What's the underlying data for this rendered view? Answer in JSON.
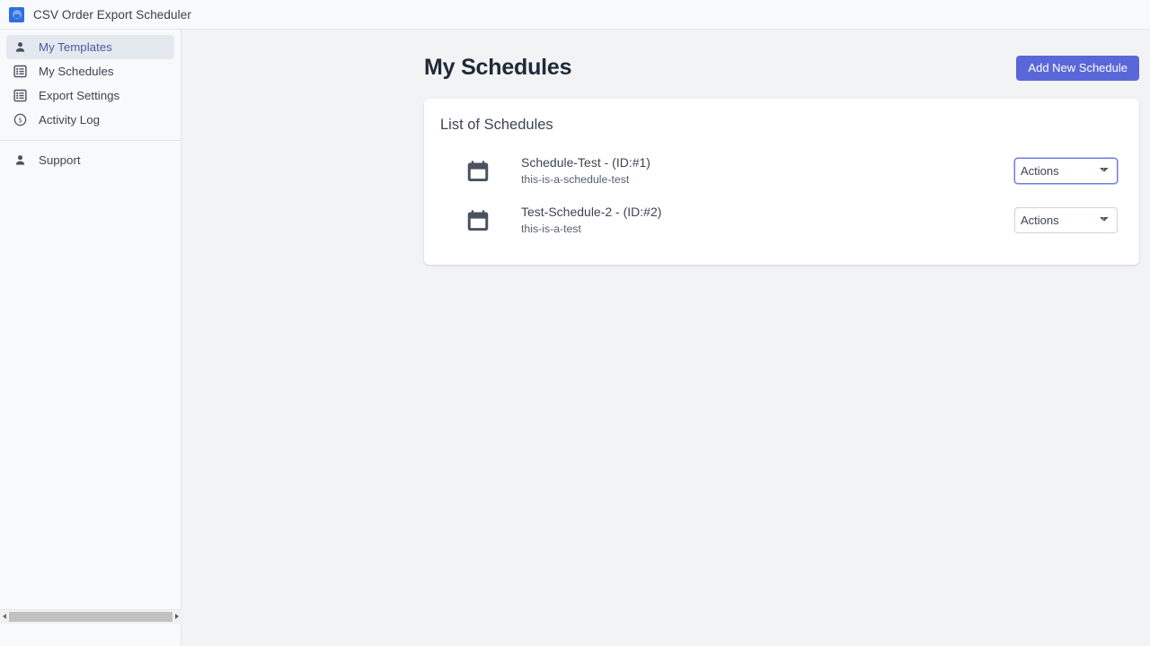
{
  "window": {
    "title": "CSV Order Export Scheduler",
    "logo_icon": "app-blue-square-icon"
  },
  "sidebar": {
    "primary_items": [
      {
        "label": "My Templates",
        "icon": "person-icon",
        "active": true
      },
      {
        "label": "My Schedules",
        "icon": "list-icon",
        "active": false
      },
      {
        "label": "Export Settings",
        "icon": "list-icon",
        "active": false
      },
      {
        "label": "Activity Log",
        "icon": "dollar-circle-icon",
        "active": false
      }
    ],
    "secondary_items": [
      {
        "label": "Support",
        "icon": "person-icon",
        "active": false
      }
    ],
    "scrollbar": {
      "left_arrow_icon": "caret-left-icon",
      "right_arrow_icon": "caret-right-icon"
    }
  },
  "main": {
    "page_title": "My Schedules",
    "add_button_label": "Add New Schedule",
    "card": {
      "title": "List of Schedules",
      "schedules": [
        {
          "name": "Schedule-Test - (ID:#1)",
          "description": "this-is-a-schedule-test",
          "icon": "calendar-icon",
          "actions_label": "Actions",
          "actions_focused": true
        },
        {
          "name": "Test-Schedule-2 - (ID:#2)",
          "description": "this-is-a-test",
          "icon": "calendar-icon",
          "actions_label": "Actions",
          "actions_focused": false
        }
      ]
    }
  },
  "colors": {
    "accent": "#5a67d8",
    "sidebar_bg": "#f8f9fa",
    "main_bg": "#f1f3f5",
    "card_bg": "#ffffff",
    "active_nav_bg": "#e4e9f0",
    "active_nav_text": "#4b5aa0",
    "heading_text": "#1f2937",
    "body_text": "#3c4552"
  }
}
